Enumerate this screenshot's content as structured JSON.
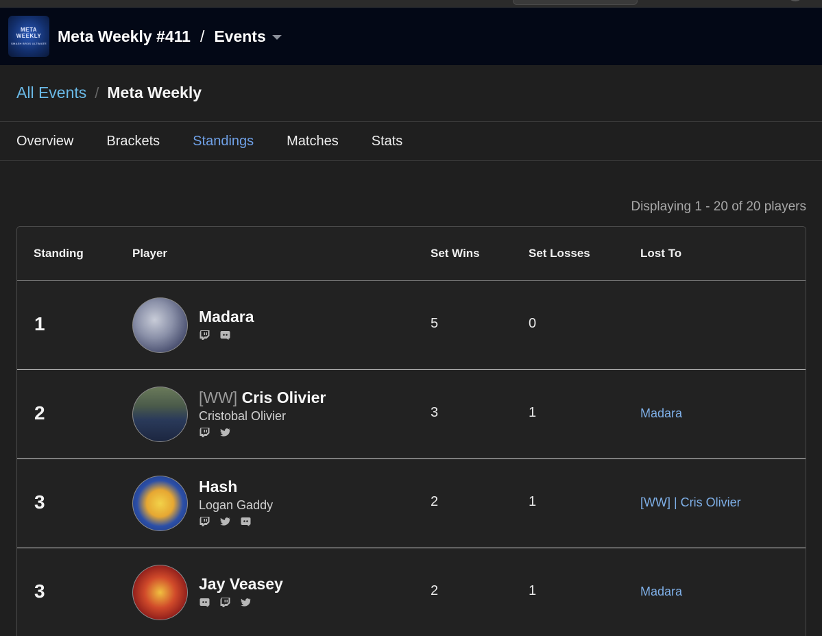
{
  "header": {
    "logo_line1": "META",
    "logo_line2": "WEEKLY",
    "logo_line3": "SMASH BROS ULTIMATE",
    "event_title": "Meta Weekly #411",
    "separator": "/",
    "section": "Events"
  },
  "breadcrumb": {
    "link": "All Events",
    "separator": "/",
    "current": "Meta Weekly"
  },
  "tabs": [
    {
      "label": "Overview",
      "active": false
    },
    {
      "label": "Brackets",
      "active": false
    },
    {
      "label": "Standings",
      "active": true
    },
    {
      "label": "Matches",
      "active": false
    },
    {
      "label": "Stats",
      "active": false
    }
  ],
  "displaying": "Displaying 1 - 20 of 20 players",
  "table": {
    "columns": {
      "standing": "Standing",
      "player": "Player",
      "set_wins": "Set Wins",
      "set_losses": "Set Losses",
      "lost_to": "Lost To"
    },
    "rows": [
      {
        "standing": "1",
        "prefix": "",
        "tag": "Madara",
        "real_name": "",
        "socials": [
          "twitch-icon",
          "discord-icon"
        ],
        "set_wins": "5",
        "set_losses": "0",
        "lost_to": ""
      },
      {
        "standing": "2",
        "prefix": "[WW]",
        "tag": "Cris Olivier",
        "real_name": "Cristobal Olivier",
        "socials": [
          "twitch-icon",
          "twitter-icon"
        ],
        "set_wins": "3",
        "set_losses": "1",
        "lost_to": "Madara"
      },
      {
        "standing": "3",
        "prefix": "",
        "tag": "Hash",
        "real_name": "Logan Gaddy",
        "socials": [
          "twitch-icon",
          "twitter-icon",
          "discord-icon"
        ],
        "set_wins": "2",
        "set_losses": "1",
        "lost_to": "[WW] | Cris Olivier"
      },
      {
        "standing": "3",
        "prefix": "",
        "tag": "Jay Veasey",
        "real_name": "",
        "socials": [
          "discord-icon",
          "twitch-icon",
          "twitter-icon"
        ],
        "set_wins": "2",
        "set_losses": "1",
        "lost_to": "Madara"
      }
    ]
  },
  "colors": {
    "header_bg": "#030816",
    "page_bg": "#1f1f1f",
    "link_blue": "#6ab9e6",
    "active_tab": "#6fa0e6",
    "lost_to_link": "#7fb0e8"
  }
}
